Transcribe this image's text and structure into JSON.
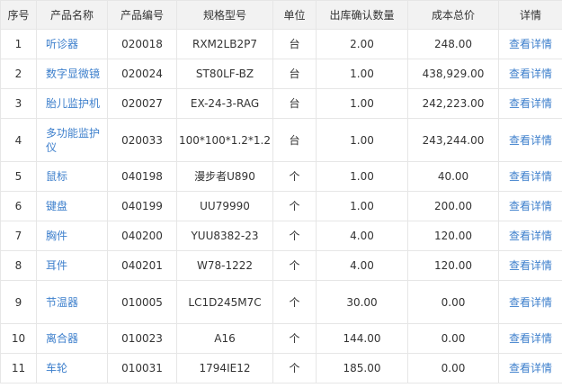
{
  "columns": [
    "序号",
    "产品名称",
    "产品编号",
    "规格型号",
    "单位",
    "出库确认数量",
    "成本总价",
    "详情"
  ],
  "rows": [
    {
      "no": "1",
      "name": "听诊器",
      "code": "020018",
      "spec": "RXM2LB2P7",
      "unit": "台",
      "qty": "2.00",
      "cost": "248.00",
      "detail": "查看详情"
    },
    {
      "no": "2",
      "name": "数字显微镜",
      "code": "020024",
      "spec": "ST80LF-BZ",
      "unit": "台",
      "qty": "1.00",
      "cost": "438,929.00",
      "detail": "查看详情"
    },
    {
      "no": "3",
      "name": "胎儿监护机",
      "code": "020027",
      "spec": "EX-24-3-RAG",
      "unit": "台",
      "qty": "1.00",
      "cost": "242,223.00",
      "detail": "查看详情"
    },
    {
      "no": "4",
      "name": "多功能监护仪",
      "code": "020033",
      "spec": "100*100*1.2*1.2",
      "unit": "台",
      "qty": "1.00",
      "cost": "243,244.00",
      "detail": "查看详情"
    },
    {
      "no": "5",
      "name": "鼠标",
      "code": "040198",
      "spec": "漫步者U890",
      "unit": "个",
      "qty": "1.00",
      "cost": "40.00",
      "detail": "查看详情"
    },
    {
      "no": "6",
      "name": "键盘",
      "code": "040199",
      "spec": "UU79990",
      "unit": "个",
      "qty": "1.00",
      "cost": "200.00",
      "detail": "查看详情"
    },
    {
      "no": "7",
      "name": "胸件",
      "code": "040200",
      "spec": "YUU8382-23",
      "unit": "个",
      "qty": "4.00",
      "cost": "120.00",
      "detail": "查看详情"
    },
    {
      "no": "8",
      "name": "耳件",
      "code": "040201",
      "spec": "W78-1222",
      "unit": "个",
      "qty": "4.00",
      "cost": "120.00",
      "detail": "查看详情"
    },
    {
      "no": "9",
      "name": "节温器",
      "code": "010005",
      "spec": "LC1D245M7C",
      "unit": "个",
      "qty": "30.00",
      "cost": "0.00",
      "detail": "查看详情"
    },
    {
      "no": "10",
      "name": "离合器",
      "code": "010023",
      "spec": "A16",
      "unit": "个",
      "qty": "144.00",
      "cost": "0.00",
      "detail": "查看详情"
    },
    {
      "no": "11",
      "name": "车轮",
      "code": "010031",
      "spec": "1794IE12",
      "unit": "个",
      "qty": "185.00",
      "cost": "0.00",
      "detail": "查看详情"
    }
  ]
}
